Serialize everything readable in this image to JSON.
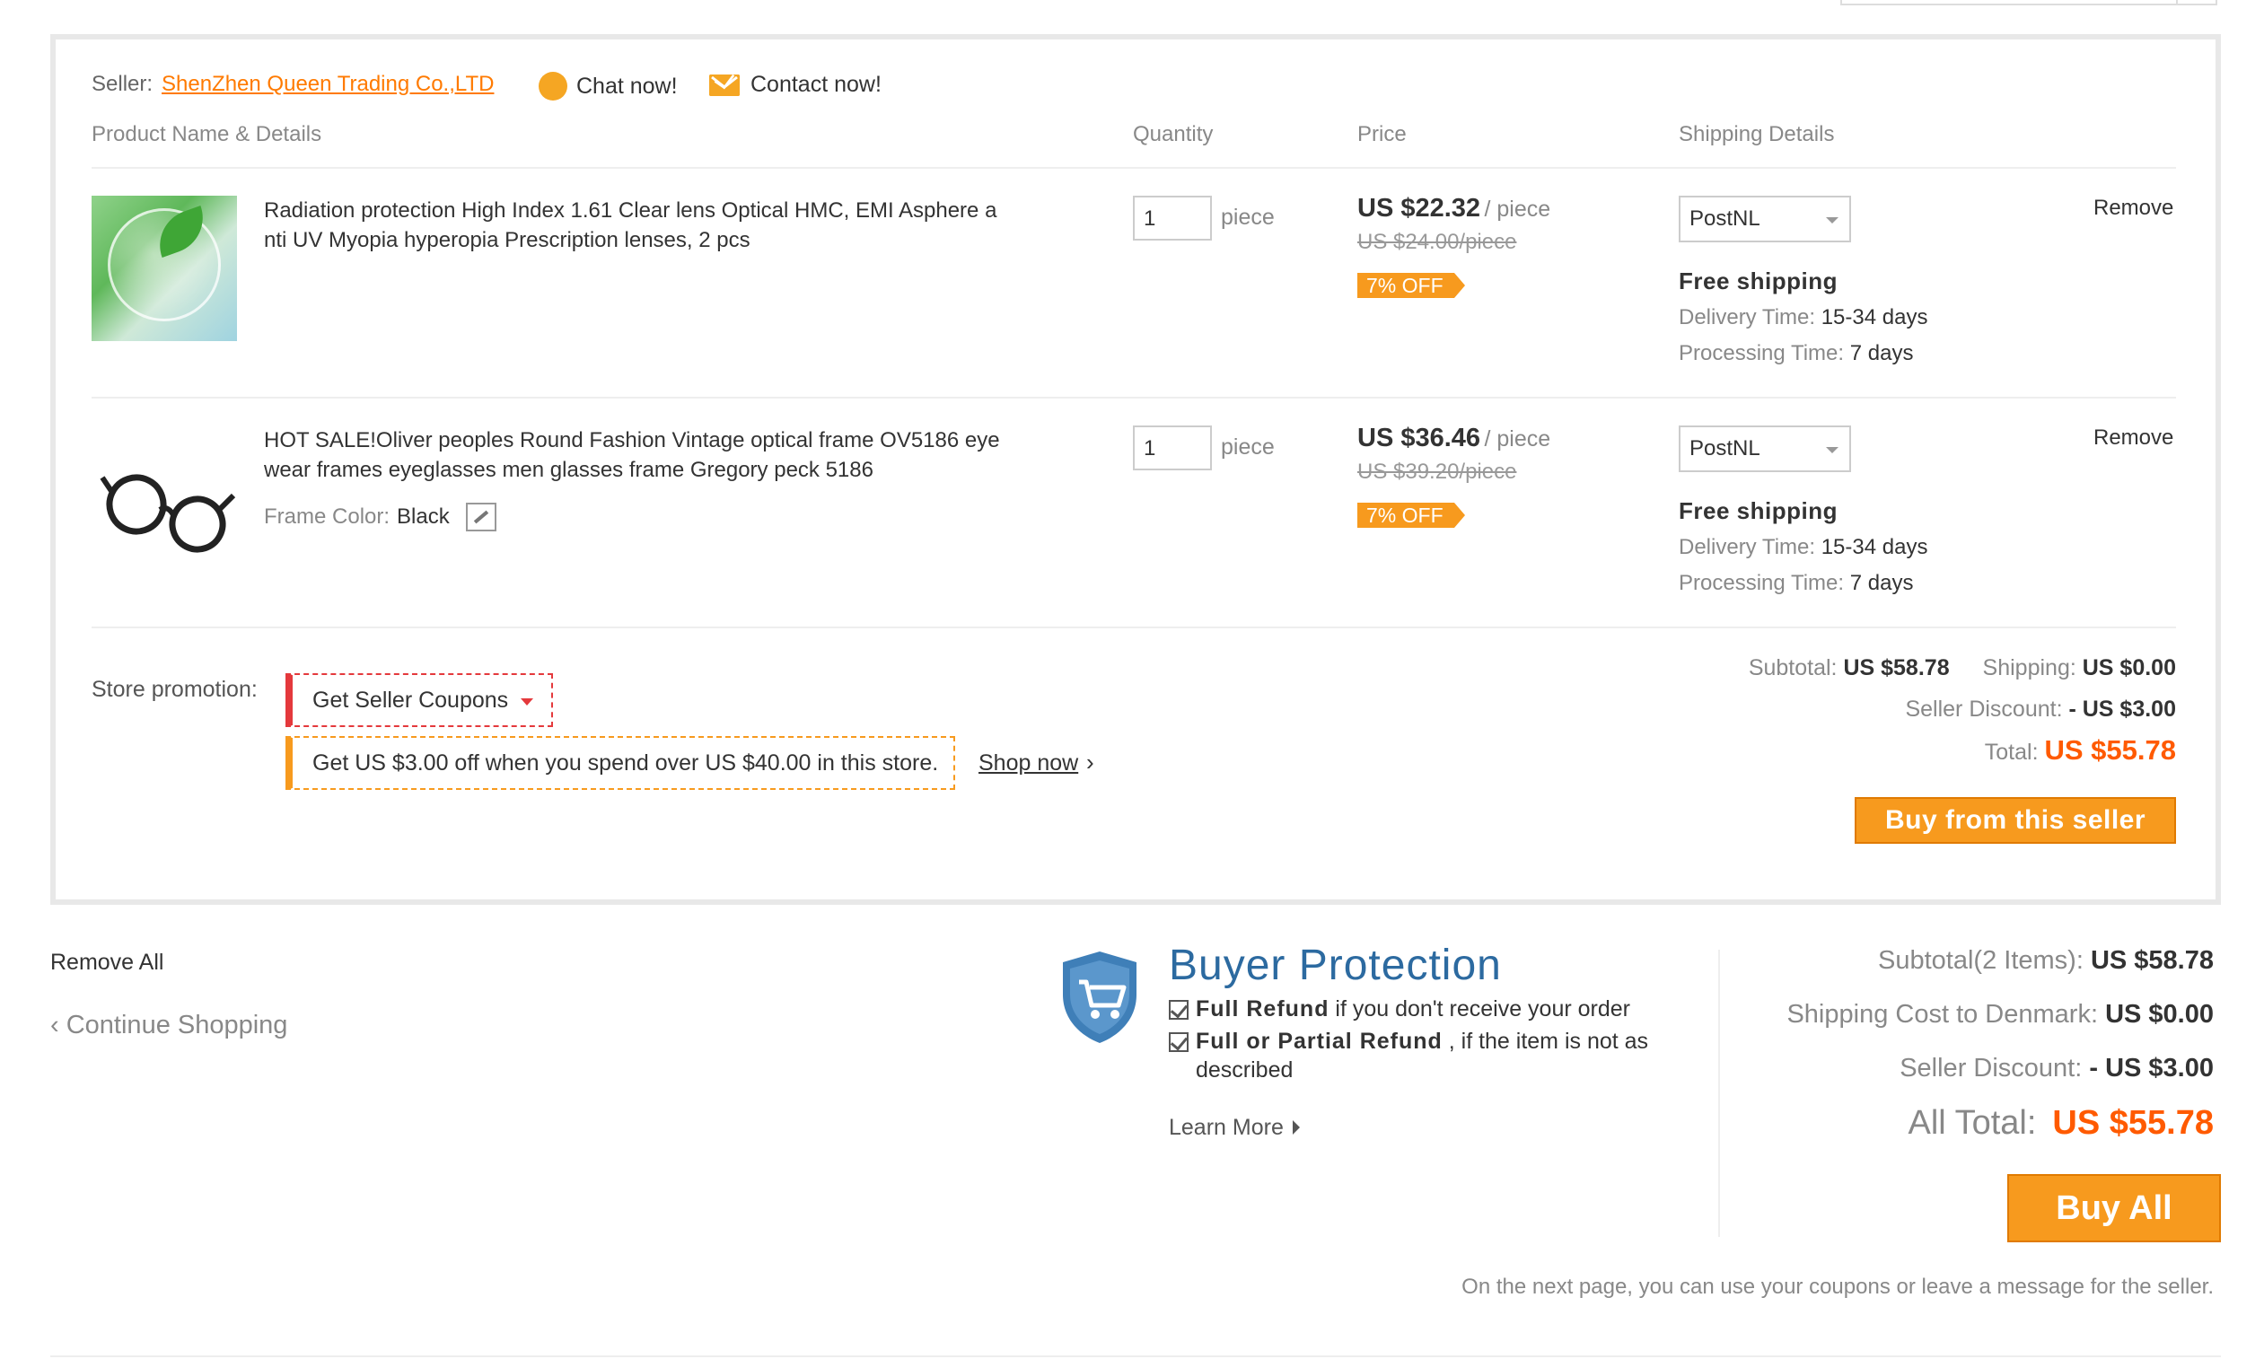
{
  "seller": {
    "label": "Seller:",
    "name": "ShenZhen Queen Trading Co.,LTD",
    "chat_label": "Chat now!",
    "contact_label": "Contact now!"
  },
  "columns": {
    "product": "Product Name & Details",
    "quantity": "Quantity",
    "price": "Price",
    "shipping": "Shipping Details"
  },
  "items": [
    {
      "name": "Radiation protection High Index 1.61 Clear lens Optical HMC, EMI Asphere anti UV Myopia hyperopia Prescription lenses, 2 pcs",
      "name_line1": "Radiation protection High Index 1.61 Clear lens Optical HMC, EMI Asphere a",
      "name_line2": "nti UV Myopia hyperopia Prescription lenses, 2 pcs",
      "quantity": "1",
      "unit": "piece",
      "price": "US $22.32",
      "per": "/ piece",
      "old_price": "US $24.00/piece",
      "discount": "7% OFF",
      "shipping_method": "PostNL",
      "free_shipping": "Free shipping",
      "delivery_label": "Delivery Time:",
      "delivery_value": "15-34 days",
      "processing_label": "Processing Time:",
      "processing_value": "7 days",
      "remove": "Remove",
      "image_icon": "lens-icon"
    },
    {
      "name": "HOT SALE!Oliver peoples Round Fashion Vintage optical frame OV5186 eye wear frames eyeglasses men glasses frame Gregory peck 5186",
      "name_line1": "HOT SALE!Oliver peoples Round Fashion Vintage optical frame OV5186 eye",
      "name_line2": "wear frames eyeglasses men glasses frame Gregory peck 5186",
      "frame_color_label": "Frame Color:",
      "frame_color_value": "Black",
      "quantity": "1",
      "unit": "piece",
      "price": "US $36.46",
      "per": "/ piece",
      "old_price": "US $39.20/piece",
      "discount": "7% OFF",
      "shipping_method": "PostNL",
      "free_shipping": "Free shipping",
      "delivery_label": "Delivery Time:",
      "delivery_value": "15-34 days",
      "processing_label": "Processing Time:",
      "processing_value": "7 days",
      "remove": "Remove",
      "image_icon": "glasses-icon"
    }
  ],
  "promotion": {
    "label": "Store promotion:",
    "coupon_button": "Get Seller Coupons",
    "offer": "Get US $3.00 off when you spend over US $40.00 in this store.",
    "shop_now": "Shop now",
    "shop_now_arrow": "›"
  },
  "store_totals": {
    "subtotal_label": "Subtotal:",
    "subtotal_value": "US $58.78",
    "shipping_label": "Shipping:",
    "shipping_value": "US $0.00",
    "discount_label": "Seller Discount:",
    "discount_value": "- US $3.00",
    "total_label": "Total:",
    "total_value": "US $55.78",
    "buy_button": "Buy from this seller"
  },
  "footer": {
    "remove_all": "Remove All",
    "continue_shopping": "Continue Shopping",
    "continue_arrow": "‹"
  },
  "buyer_protection": {
    "title": "Buyer Protection",
    "line1_bold": "Full Refund",
    "line1_rest": " if you don't receive your order",
    "line2_bold": "Full or Partial Refund",
    "line2_rest": " , if the item is not as",
    "line2_cont": "described",
    "learn_more": "Learn More"
  },
  "summary": {
    "subtotal_label": "Subtotal(2 Items):",
    "subtotal_value": "US $58.78",
    "shipping_label": "Shipping Cost to Denmark:",
    "shipping_value": "US $0.00",
    "discount_label": "Seller Discount:",
    "discount_value": "- US $3.00",
    "all_total_label": "All Total:",
    "all_total_value": "US $55.78",
    "buy_all": "Buy All",
    "note": "On the next page, you can use your coupons or leave a message for the seller."
  },
  "colors": {
    "accent_orange": "#f79a1e",
    "total_red": "#ff5a00",
    "coupon_red": "#e4393c",
    "protection_blue": "#2c6aa0"
  }
}
